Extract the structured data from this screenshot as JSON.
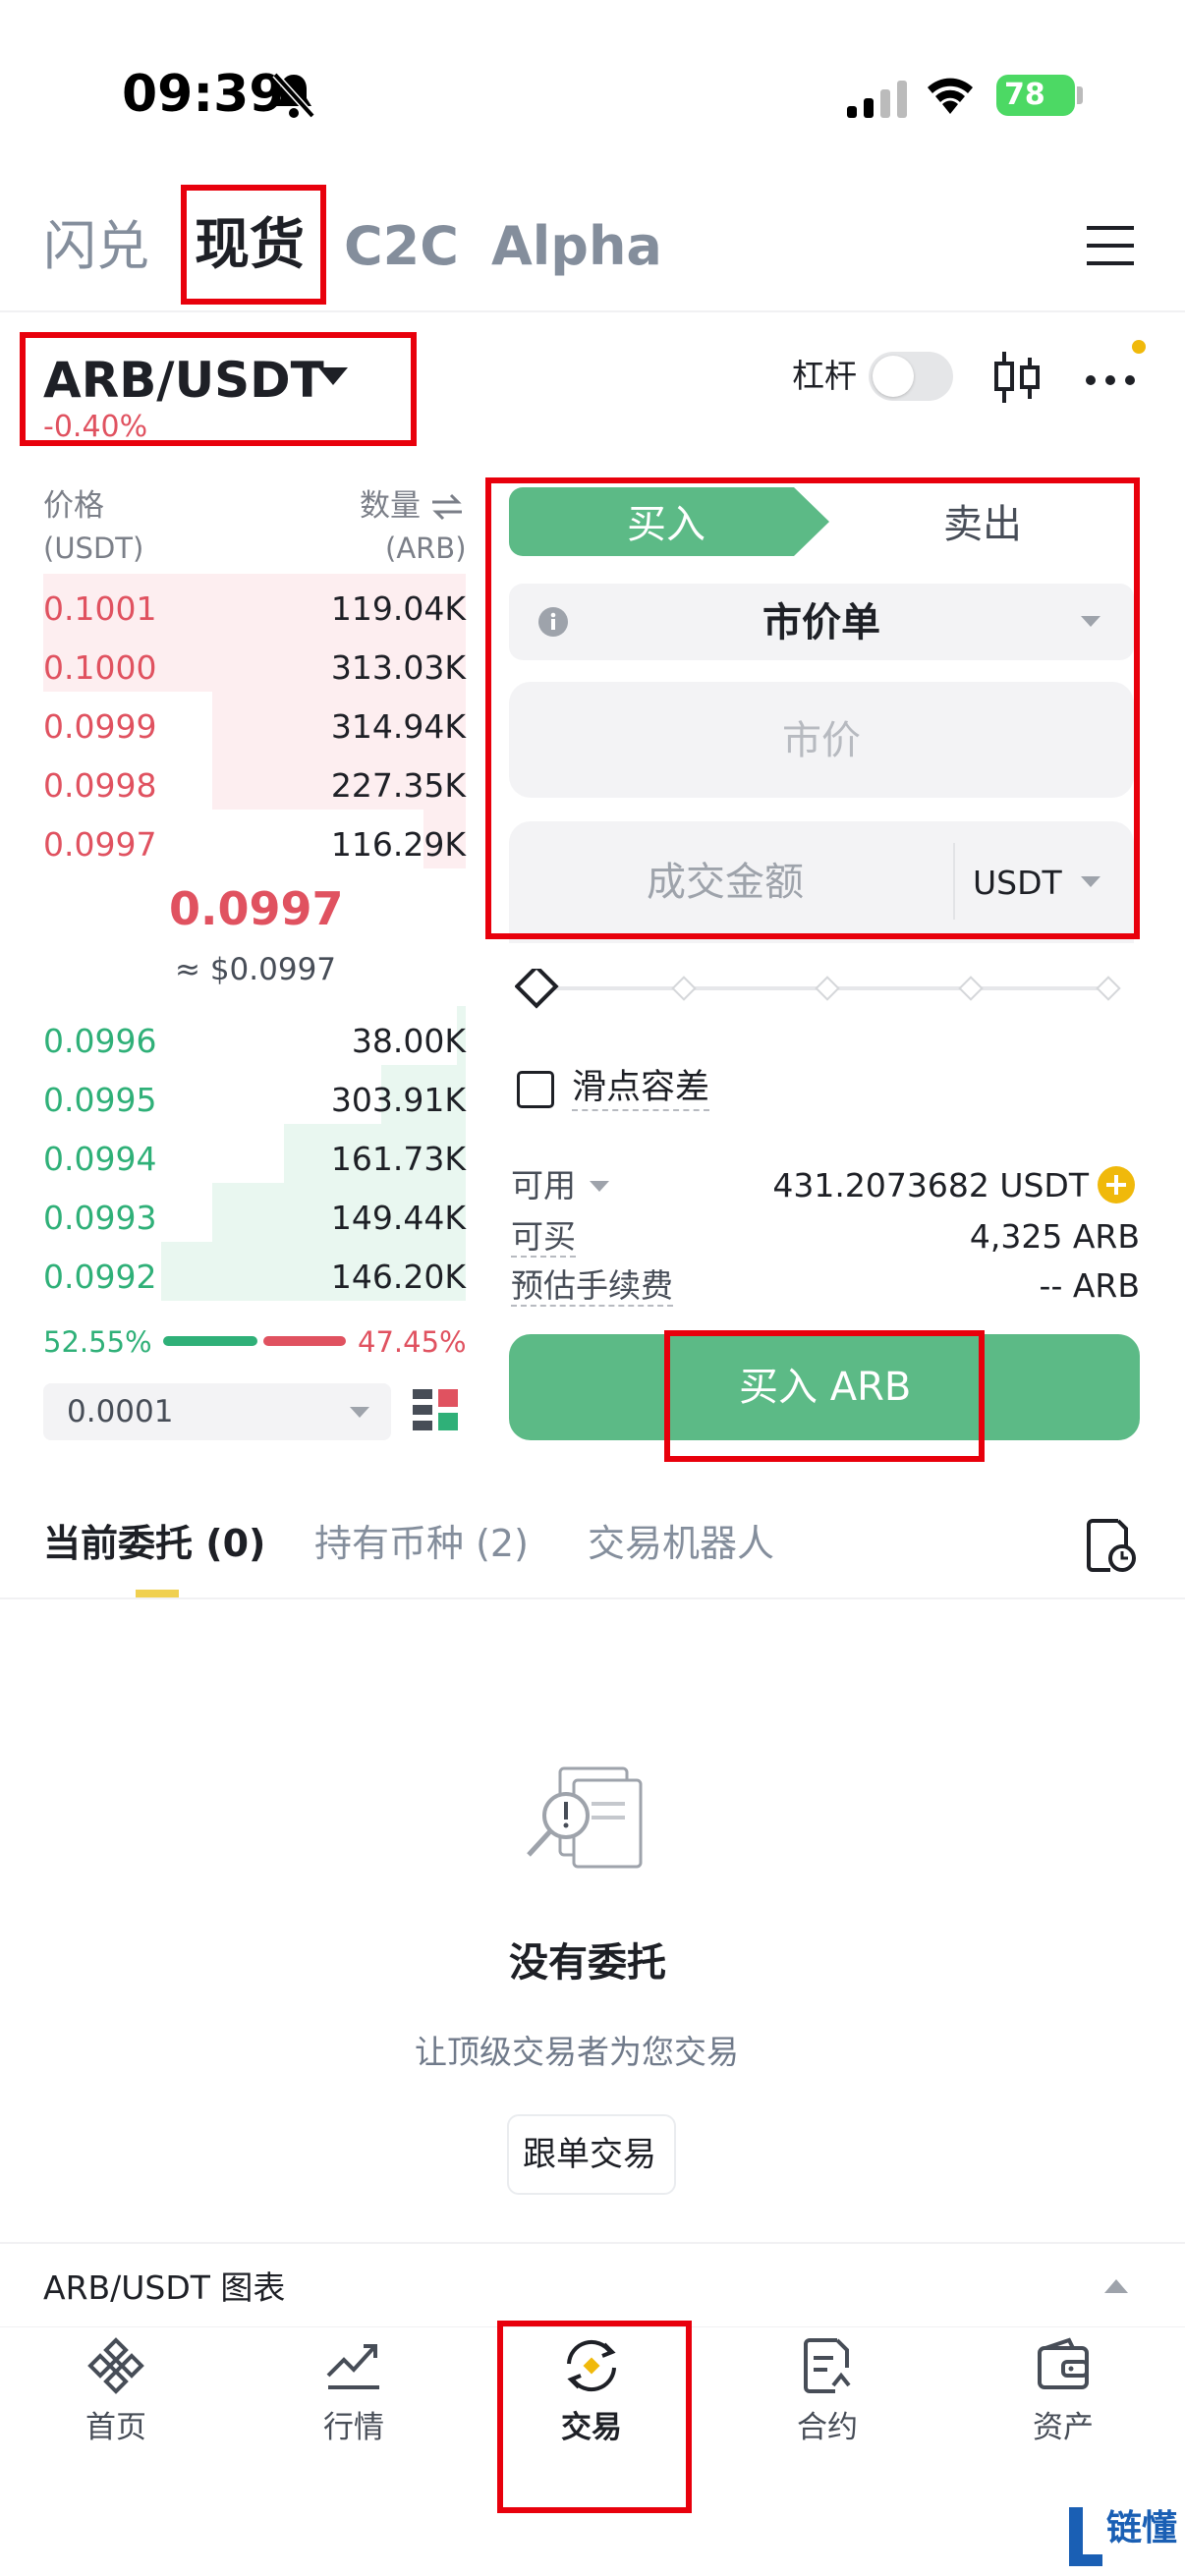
{
  "status_bar": {
    "time": "09:39",
    "battery": "78"
  },
  "top_tabs": [
    {
      "label": "闪兑",
      "active": false
    },
    {
      "label": "现货",
      "active": true
    },
    {
      "label": "C2C",
      "active": false
    },
    {
      "label": "Alpha",
      "active": false
    }
  ],
  "pair": {
    "symbol": "ARB/USDT",
    "change": "-0.40%",
    "leverage_label": "杠杆"
  },
  "orderbook": {
    "price_header": "价格",
    "price_unit": "(USDT)",
    "qty_header": "数量",
    "qty_unit": "(ARB)",
    "asks": [
      {
        "price": "0.1001",
        "qty": "119.04K",
        "depth": 1.0
      },
      {
        "price": "0.1000",
        "qty": "313.03K",
        "depth": 1.0
      },
      {
        "price": "0.0999",
        "qty": "314.94K",
        "depth": 0.6
      },
      {
        "price": "0.0998",
        "qty": "227.35K",
        "depth": 0.6
      },
      {
        "price": "0.0997",
        "qty": "116.29K",
        "depth": 0.1
      }
    ],
    "last_price": "0.0997",
    "last_price_usd": "≈ $0.0997",
    "bids": [
      {
        "price": "0.0996",
        "qty": "38.00K",
        "depth": 0.02
      },
      {
        "price": "0.0995",
        "qty": "303.91K",
        "depth": 0.2
      },
      {
        "price": "0.0994",
        "qty": "161.73K",
        "depth": 0.43
      },
      {
        "price": "0.0993",
        "qty": "149.44K",
        "depth": 0.6
      },
      {
        "price": "0.0992",
        "qty": "146.20K",
        "depth": 0.72
      }
    ],
    "buy_ratio": "52.55%",
    "sell_ratio": "47.45%",
    "buy_ratio_value": 0.5255,
    "precision": "0.0001"
  },
  "order_form": {
    "buy_tab": "买入",
    "sell_tab": "卖出",
    "order_type": "市价单",
    "price_placeholder": "市价",
    "amount_placeholder": "成交金额",
    "amount_unit": "USDT",
    "slippage_label": "滑点容差",
    "available_label": "可用",
    "available_value": "431.2073682 USDT",
    "can_buy_label": "可买",
    "can_buy_value": "4,325 ARB",
    "fee_label": "预估手续费",
    "fee_value": "-- ARB",
    "submit_label": "买入 ARB"
  },
  "orders_tabs": [
    {
      "label": "当前委托 (0)",
      "active": true
    },
    {
      "label": "持有币种 (2)",
      "active": false
    },
    {
      "label": "交易机器人",
      "active": false
    }
  ],
  "empty_state": {
    "title": "没有委托",
    "subtitle": "让顶级交易者为您交易",
    "button": "跟单交易"
  },
  "chart_bar": {
    "label": "ARB/USDT 图表"
  },
  "bottom_nav": [
    {
      "label": "首页",
      "icon": "binance-logo-icon",
      "active": false
    },
    {
      "label": "行情",
      "icon": "market-chart-icon",
      "active": false
    },
    {
      "label": "交易",
      "icon": "trade-swap-icon",
      "active": true
    },
    {
      "label": "合约",
      "icon": "futures-doc-icon",
      "active": false
    },
    {
      "label": "资产",
      "icon": "wallet-icon",
      "active": false
    }
  ],
  "watermark": {
    "text": "链懂"
  },
  "colors": {
    "green": "#2fb078",
    "red": "#e05260",
    "buy_button": "#5cba86",
    "highlight_box": "#e8000c",
    "accent_yellow": "#f0b90b"
  }
}
